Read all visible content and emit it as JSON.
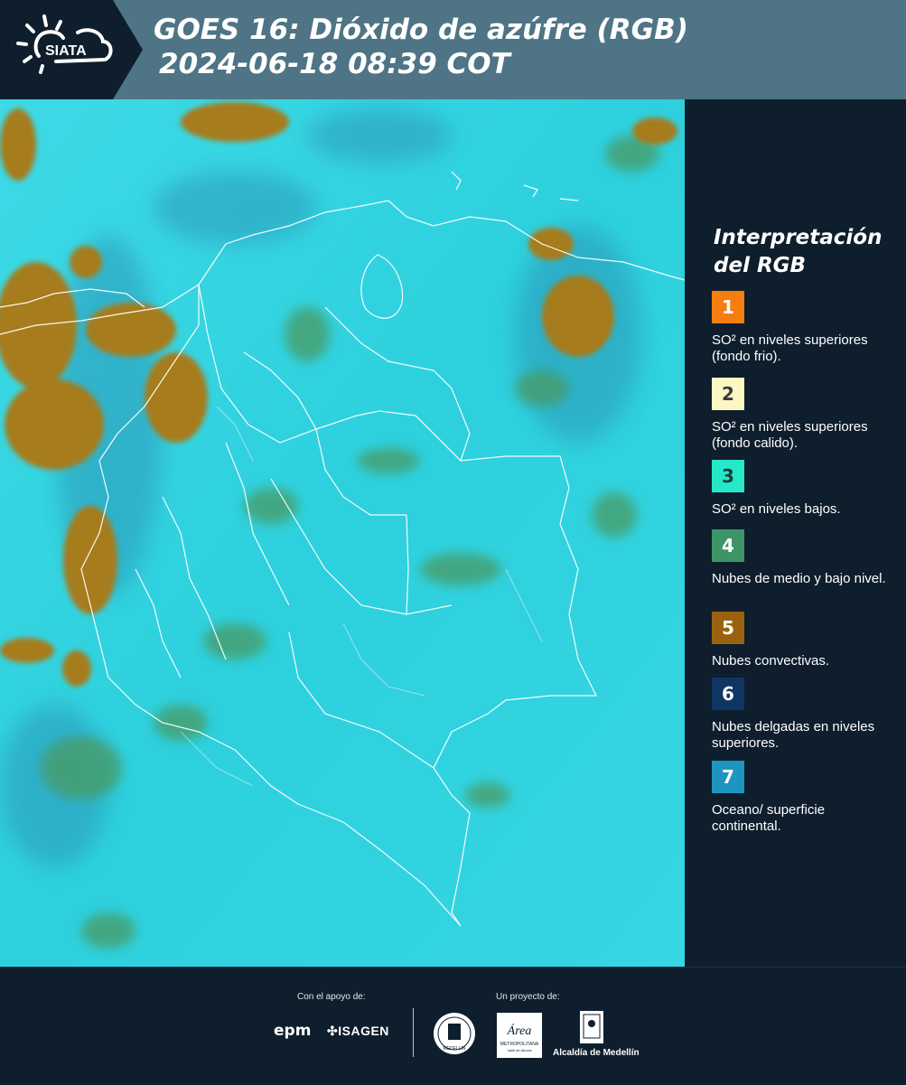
{
  "header": {
    "brand": "SIATA",
    "title_line1": "GOES 16: Dióxido de azúfre (RGB)",
    "title_line2": "2024-06-18 08:39 COT"
  },
  "legend": {
    "title_line1": "Interpretación",
    "title_line2": "del RGB",
    "items": [
      {
        "number": "1",
        "label": "SO² en niveles superiores (fondo frio).",
        "color": "#f57e10",
        "text_color": "#ffffff"
      },
      {
        "number": "2",
        "label": "SO² en niveles superiores (fondo calido).",
        "color": "#fdf7c3",
        "text_color": "#3a3a3a"
      },
      {
        "number": "3",
        "label": "SO² en niveles bajos.",
        "color": "#25e8c9",
        "text_color": "#1a3d3a"
      },
      {
        "number": "4",
        "label": "Nubes de medio y bajo nivel.",
        "color": "#3d9467",
        "text_color": "#ffffff"
      },
      {
        "number": "5",
        "label": "Nubes convectivas.",
        "color": "#9a620f",
        "text_color": "#ffffff"
      },
      {
        "number": "6",
        "label": "Nubes delgadas en niveles superiores.",
        "color": "#0e3563",
        "text_color": "#ffffff"
      },
      {
        "number": "7",
        "label": "Oceano/ superficie continental.",
        "color": "#1d95c0",
        "text_color": "#ffffff"
      }
    ]
  },
  "footer": {
    "support_label": "Con el apoyo de:",
    "project_label": "Un proyecto de:",
    "sponsors": [
      "epm",
      "ISAGEN"
    ],
    "partner_metro_line1": "Área",
    "partner_metro_line2": "METROPOLITANA",
    "partner_metro_line3": "Valle de Aburrá",
    "partner_alcaldia": "Alcaldía de Medellín",
    "seal_text": "MEDELLÍN"
  },
  "colors": {
    "header_bg": "#4e7485",
    "logo_bg": "#0e1e2c",
    "page_bg": "#0e1e2c",
    "map_ocean": "#2fd3df",
    "cloud_convective": "#9e7a1c",
    "cloud_mid": "#3f9a6a"
  }
}
